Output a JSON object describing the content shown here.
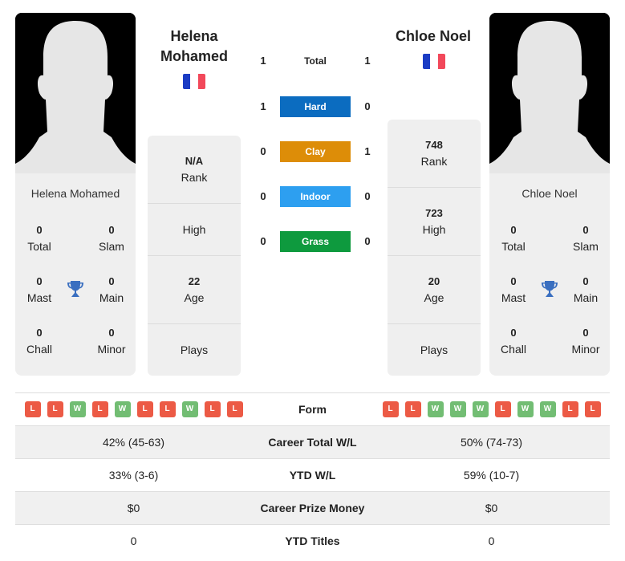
{
  "players": [
    {
      "name": "Helena Mohamed",
      "name_line1": "Helena",
      "name_line2": "Mohamed",
      "country_flag": "france-flag",
      "titles": {
        "total": {
          "value": "0",
          "label": "Total"
        },
        "slam": {
          "value": "0",
          "label": "Slam"
        },
        "mast": {
          "value": "0",
          "label": "Mast"
        },
        "main": {
          "value": "0",
          "label": "Main"
        },
        "chall": {
          "value": "0",
          "label": "Chall"
        },
        "minor": {
          "value": "0",
          "label": "Minor"
        }
      },
      "rank": {
        "value": "N/A",
        "label": "Rank"
      },
      "high": {
        "value": "",
        "label": "High"
      },
      "age": {
        "value": "22",
        "label": "Age"
      },
      "plays": {
        "value": "",
        "label": "Plays"
      },
      "form": [
        "L",
        "L",
        "W",
        "L",
        "W",
        "L",
        "L",
        "W",
        "L",
        "L"
      ],
      "career_total_wl": "42% (45-63)",
      "ytd_wl": "33% (3-6)",
      "career_prize_money": "$0",
      "ytd_titles": "0"
    },
    {
      "name": "Chloe Noel",
      "name_line1": "Chloe Noel",
      "name_line2": "",
      "country_flag": "france-flag",
      "titles": {
        "total": {
          "value": "0",
          "label": "Total"
        },
        "slam": {
          "value": "0",
          "label": "Slam"
        },
        "mast": {
          "value": "0",
          "label": "Mast"
        },
        "main": {
          "value": "0",
          "label": "Main"
        },
        "chall": {
          "value": "0",
          "label": "Chall"
        },
        "minor": {
          "value": "0",
          "label": "Minor"
        }
      },
      "rank": {
        "value": "748",
        "label": "Rank"
      },
      "high": {
        "value": "723",
        "label": "High"
      },
      "age": {
        "value": "20",
        "label": "Age"
      },
      "plays": {
        "value": "",
        "label": "Plays"
      },
      "form": [
        "L",
        "L",
        "W",
        "W",
        "W",
        "L",
        "W",
        "W",
        "L",
        "L"
      ],
      "career_total_wl": "50% (74-73)",
      "ytd_wl": "59% (10-7)",
      "career_prize_money": "$0",
      "ytd_titles": "0"
    }
  ],
  "h2h": [
    {
      "surface": "Total",
      "left": "1",
      "right": "1",
      "color": ""
    },
    {
      "surface": "Hard",
      "left": "1",
      "right": "0",
      "color": "#0b6cc0"
    },
    {
      "surface": "Clay",
      "left": "0",
      "right": "1",
      "color": "#dd8d08"
    },
    {
      "surface": "Indoor",
      "left": "0",
      "right": "0",
      "color": "#2d9ff0"
    },
    {
      "surface": "Grass",
      "left": "0",
      "right": "0",
      "color": "#0e9a3e"
    }
  ],
  "table_labels": {
    "form": "Form",
    "career_total_wl": "Career Total W/L",
    "ytd_wl": "YTD W/L",
    "career_prize_money": "Career Prize Money",
    "ytd_titles": "YTD Titles"
  },
  "colors": {
    "win": "#72bd73",
    "loss": "#ec5a45",
    "trophy": "#3a6fc0"
  }
}
